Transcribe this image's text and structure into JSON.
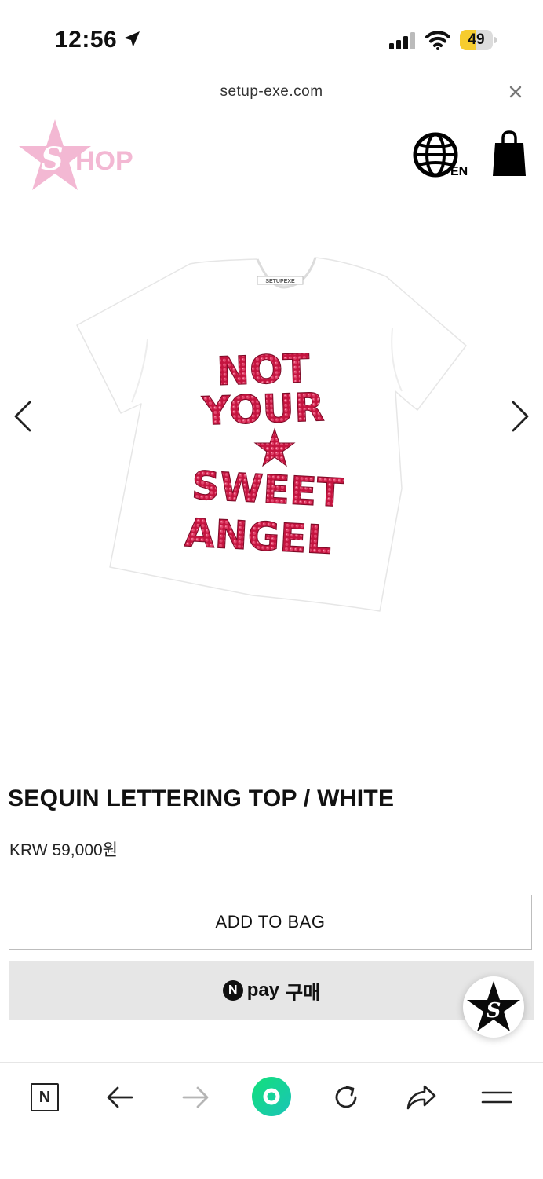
{
  "status_bar": {
    "time": "12:56",
    "battery_level": "49",
    "battery_fraction": 0.49,
    "location_icon": "location-arrow-icon",
    "signal_icon": "cellular-signal-icon",
    "wifi_icon": "wifi-icon"
  },
  "browser": {
    "url": "setup-exe.com",
    "close_icon": "close-icon"
  },
  "header": {
    "logo_text": "SHOP",
    "language_label": "EN",
    "globe_icon": "globe-icon",
    "bag_icon": "shopping-bag-icon"
  },
  "product_image": {
    "tag_text": "SETUPEXE",
    "print_lines": [
      "NOT",
      "YOUR",
      "SWEET",
      "ANGEL"
    ]
  },
  "product": {
    "title": "SEQUIN LETTERING TOP / WHITE",
    "price": "KRW 59,000원"
  },
  "actions": {
    "add_to_bag": "ADD TO BAG",
    "npay_n": "N",
    "npay_pay": "pay",
    "npay_buy": "구매"
  },
  "toolbar": {
    "naver_label": "N"
  },
  "colors": {
    "logo_pink": "#f3b8d3",
    "sequin_red": "#c4143f",
    "battery_yellow": "#f6cc2e",
    "home_green": "#18d18a"
  }
}
